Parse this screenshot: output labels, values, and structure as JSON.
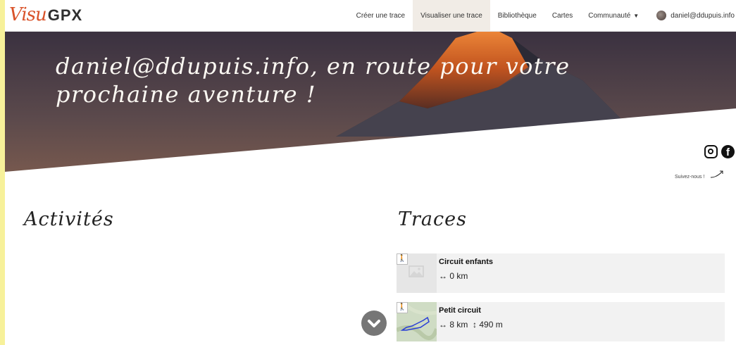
{
  "app": {
    "logo_script": "Visu",
    "logo_bold": "GPX"
  },
  "nav": {
    "items": [
      {
        "label": "Créer une trace",
        "active": false
      },
      {
        "label": "Visualiser une trace",
        "active": true
      },
      {
        "label": "Bibliothèque",
        "active": false
      },
      {
        "label": "Cartes",
        "active": false
      },
      {
        "label": "Communauté",
        "active": false
      }
    ],
    "user": "daniel@ddupuis.info"
  },
  "hero": {
    "line1": "daniel@ddupuis.info, en route pour votre",
    "line2": "prochaine aventure !"
  },
  "social": {
    "follow_text": "Suivez-nous !",
    "icons": [
      "instagram-icon",
      "facebook-icon"
    ]
  },
  "sections": {
    "activities": "Activités",
    "traces": "Traces"
  },
  "traces": [
    {
      "name": "Circuit enfants",
      "distance": "↔ 0 km",
      "elevation": ""
    },
    {
      "name": "Petit circuit",
      "distance": "↔ 8 km",
      "elevation": "↕ 490 m"
    }
  ],
  "colors": {
    "accent": "#d9532a",
    "active_nav_bg": "#f1ece6",
    "card_bg": "#f2f2f2"
  }
}
